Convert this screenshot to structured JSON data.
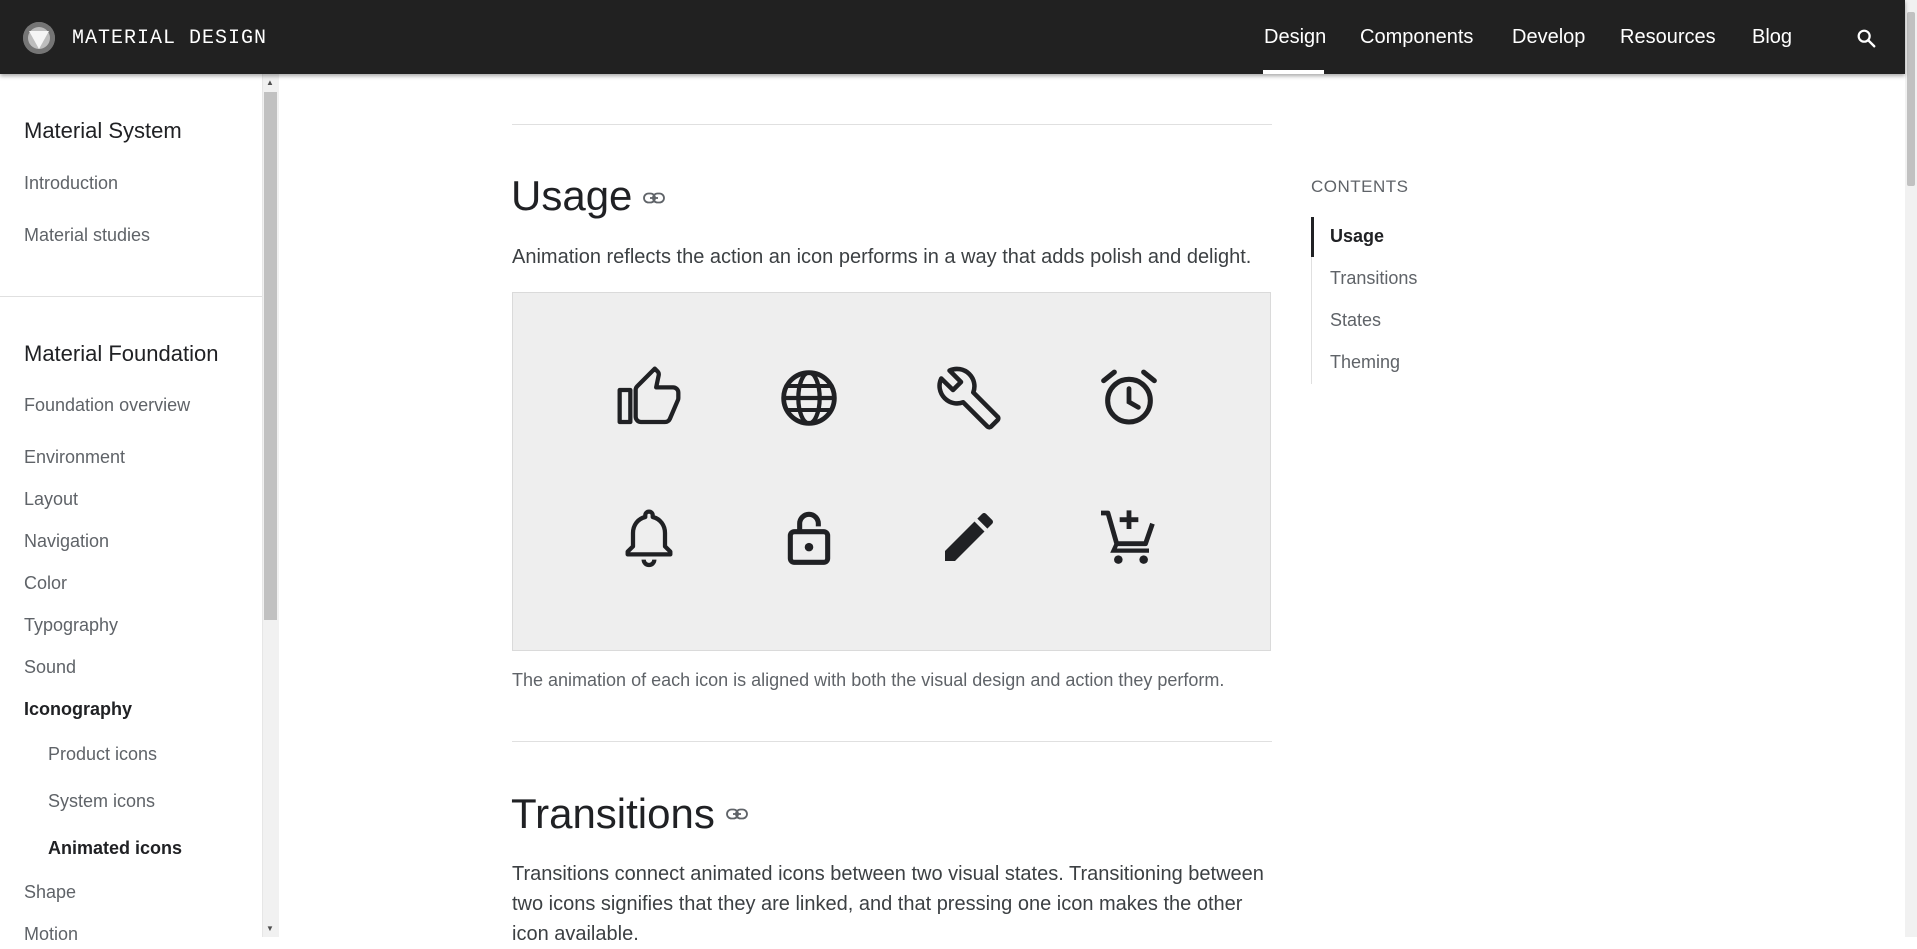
{
  "topbar": {
    "brand": "MATERIAL DESIGN",
    "nav": [
      "Design",
      "Components",
      "Develop",
      "Resources",
      "Blog"
    ],
    "active_nav": "Design",
    "search_icon": "search-icon"
  },
  "sidebar": {
    "section1_title": "Material System",
    "section1_items": [
      "Introduction",
      "Material studies"
    ],
    "section2_title": "Material Foundation",
    "section2_items": [
      "Foundation overview",
      "Environment",
      "Layout",
      "Navigation",
      "Color",
      "Typography",
      "Sound",
      "Iconography"
    ],
    "iconography_sub": [
      "Product icons",
      "System icons",
      "Animated icons"
    ],
    "after_items": [
      "Shape",
      "Motion"
    ],
    "active_item": "Iconography",
    "active_sub": "Animated icons"
  },
  "main": {
    "usage": {
      "heading": "Usage",
      "text": "Animation reflects the action an icon performs in a way that adds polish and delight.",
      "figure_icons": [
        "thumb-up-icon",
        "globe-icon",
        "wrench-icon",
        "alarm-icon",
        "bell-icon",
        "unlocked-icon",
        "pencil-icon",
        "add-to-cart-icon"
      ],
      "caption": "The animation of each icon is aligned with both the visual design and action they perform."
    },
    "transitions": {
      "heading": "Transitions",
      "text": "Transitions connect animated icons between two visual states. Transitioning between two icons signifies that they are linked, and that pressing one icon makes the other icon available."
    }
  },
  "toc": {
    "title": "CONTENTS",
    "items": [
      "Usage",
      "Transitions",
      "States",
      "Theming"
    ],
    "active": "Usage"
  },
  "colors": {
    "topbar_bg": "#212121",
    "figure_bg": "#eeeeee",
    "text_primary": "#202124",
    "text_secondary": "#5f6368"
  }
}
